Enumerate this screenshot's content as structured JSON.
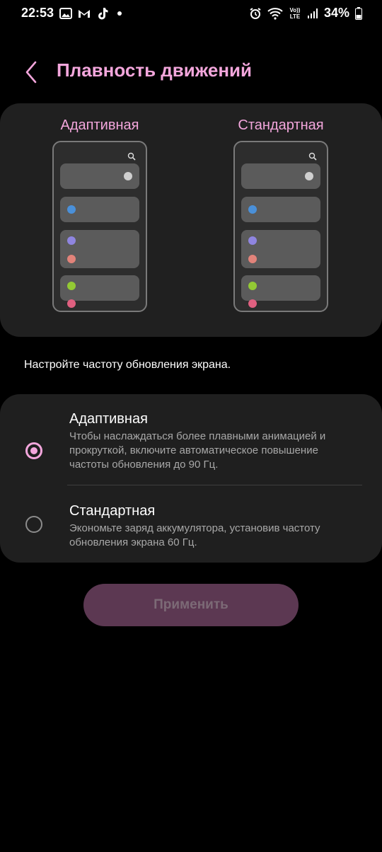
{
  "status_bar": {
    "time": "22:53",
    "left_icons": [
      "gallery-icon",
      "gmail-icon",
      "tiktok-icon"
    ],
    "right_icons": [
      "alarm-icon",
      "wifi-icon",
      "volte-lte-icon",
      "signal-icon"
    ],
    "battery_percent": "34%",
    "volte_label": "Vo)) LTE"
  },
  "header": {
    "title": "Плавность движений",
    "back_icon": "chevron-left-icon"
  },
  "preview": {
    "adaptive_label": "Адаптивная",
    "standard_label": "Стандартная"
  },
  "subtitle": "Настройте частоту обновления экрана.",
  "options": [
    {
      "title": "Адаптивная",
      "description": "Чтобы наслаждаться более плавными анимацией и прокруткой, включите автоматическое повышение частоты обновления до 90 Гц.",
      "selected": true
    },
    {
      "title": "Стандартная",
      "description": "Экономьте заряд аккумулятора, установив частоту обновления экрана 60 Гц.",
      "selected": false
    }
  ],
  "apply_button": {
    "label": "Применить"
  },
  "colors": {
    "accent": "#f3a6dc",
    "dot_grey": "#cfcfcf",
    "dot_blue": "#4a90d9",
    "dot_purple": "#8f85e0",
    "dot_salmon": "#e2837a",
    "dot_green": "#93c934",
    "dot_pink": "#e06080"
  }
}
